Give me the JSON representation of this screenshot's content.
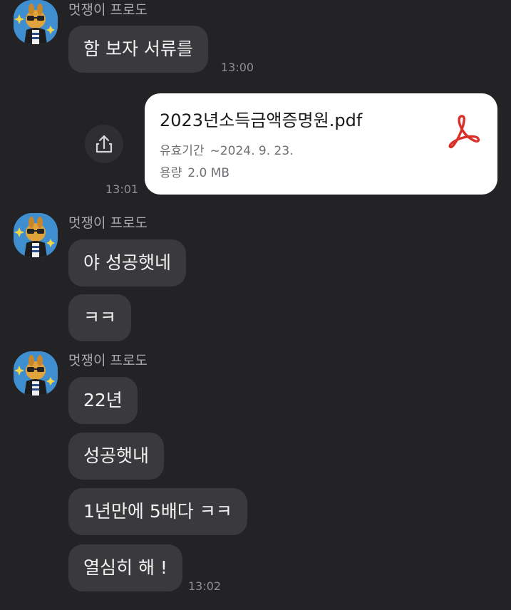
{
  "colors": {
    "background": "#232326",
    "bubble": "#3a3a3d",
    "file_card": "#ffffff",
    "pdf_icon": "#d9302a",
    "avatar_bg": "#3f8fd0"
  },
  "messages": {
    "group1": {
      "sender": "멋쟁이 프로도",
      "bubbles": [
        "함 보자 서류를"
      ],
      "time": "13:00"
    },
    "file": {
      "name": "2023년소득금액증명원.pdf",
      "validity_label": "유효기간",
      "validity_value": "~2024. 9. 23.",
      "size_label": "용량",
      "size_value": "2.0 MB",
      "icon": "pdf-icon",
      "share_icon": "share-icon",
      "time": "13:01"
    },
    "group2": {
      "sender": "멋쟁이 프로도",
      "bubbles": [
        "야 성공햇네",
        "ㅋㅋ"
      ]
    },
    "group3": {
      "sender": "멋쟁이 프로도",
      "bubbles": [
        "22년",
        "성공햇내",
        "1년만에 5배다 ㅋㅋ",
        "열심히 해 !"
      ],
      "time": "13:02"
    }
  }
}
